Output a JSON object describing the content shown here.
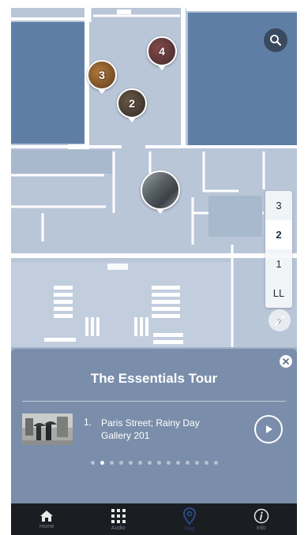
{
  "map": {
    "pins": [
      {
        "id": "pin-3",
        "label": "3"
      },
      {
        "id": "pin-4",
        "label": "4"
      },
      {
        "id": "pin-2",
        "label": "2"
      },
      {
        "id": "pin-current",
        "label": ""
      }
    ]
  },
  "floors": [
    {
      "label": "3",
      "active": false
    },
    {
      "label": "2",
      "active": true
    },
    {
      "label": "1",
      "active": false
    },
    {
      "label": "LL",
      "active": false
    }
  ],
  "panel": {
    "title": "The Essentials Tour",
    "stop": {
      "number": "1.",
      "title": "Paris Street; Rainy Day",
      "subtitle": "Gallery 201"
    },
    "dots_total": 14,
    "dots_active_index": 1
  },
  "tabs": [
    {
      "label": "Home",
      "icon": "home-icon",
      "active": false
    },
    {
      "label": "Audio",
      "icon": "keypad-icon",
      "active": false
    },
    {
      "label": "Map",
      "icon": "location-pin-icon",
      "active": true
    },
    {
      "label": "Info",
      "icon": "info-icon",
      "active": false
    }
  ],
  "colors": {
    "map_floor": "#c5d0de",
    "map_walls": "#ffffff",
    "map_dark_block": "#5c7aa0",
    "panel": "#7a8eab",
    "tabbar": "#1a1d22",
    "active_tab": "#2b3e66"
  }
}
